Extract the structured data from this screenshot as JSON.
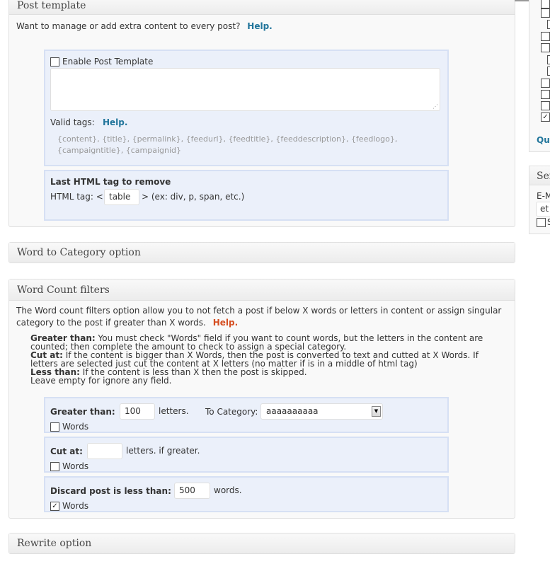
{
  "post_template": {
    "title": "Post template",
    "intro": "Want to manage or add extra content to every post?",
    "help": "Help.",
    "enable_label": "Enable Post Template",
    "textarea_value": "",
    "valid_tags_label": "Valid tags:",
    "valid_tags_help": "Help.",
    "tags_line1": "{content}, {title}, {permalink}, {feedurl}, {feedtitle}, {feeddescription}, {feedlogo},",
    "tags_line2": "{campaigntitle}, {campaignid}",
    "last_html_title": "Last HTML tag to remove",
    "html_tag_label": "HTML tag: <",
    "html_tag_value": "table",
    "html_tag_suffix": "> (ex: div, p, span, etc.)"
  },
  "word_to_category": {
    "title": "Word to Category option"
  },
  "word_count": {
    "title": "Word Count filters",
    "intro_line1": "The Word count filters option allow you to not fetch a post if below X words or letters in content or assign singular",
    "intro_line2": "category to the post if greater than X words.",
    "help": "Help.",
    "desc": {
      "greater_label": "Greater than:",
      "greater_text1": " You must check \"Words\" field if you want to count words, but the letters in the content are",
      "greater_text2": "counted; then complete the amount to check to assign a special category.",
      "cut_label": "Cut at:",
      "cut_text1": " If the content is bigger than X Words, then the post is converted to text and cutted at X Words. If",
      "cut_text2": "letters are selected just cut the content at X letters (no matter if is in a middle of html tag)",
      "less_label": "Less than:",
      "less_text": " If the content is less than X then the post is skipped.",
      "empty_text": "Leave empty for ignore any field."
    },
    "greater": {
      "label": "Greater than:",
      "value": "100",
      "unit": "letters.",
      "category_label": "To Category:",
      "category_value": "aaaaaaaaaa",
      "words_label": "Words",
      "words_checked": false
    },
    "cut": {
      "label": "Cut at:",
      "value": "",
      "unit": "letters. if greater.",
      "words_label": "Words",
      "words_checked": false
    },
    "discard": {
      "label": "Discard post is less than:",
      "value": "500",
      "unit": "words.",
      "words_label": "Words",
      "words_checked": true
    }
  },
  "rewrite": {
    "title": "Rewrite option"
  },
  "sidebar": {
    "checked_mark": "✓",
    "quick_link": "Qu",
    "send_title": "Sen",
    "email_label": "E-M",
    "email_value": "et",
    "s_label": "S"
  },
  "colors": {
    "link": "#21759b",
    "help_accent": "#d54e21",
    "subbox_bg": "#ebf0fa",
    "subbox_border": "#d6e0f4"
  }
}
